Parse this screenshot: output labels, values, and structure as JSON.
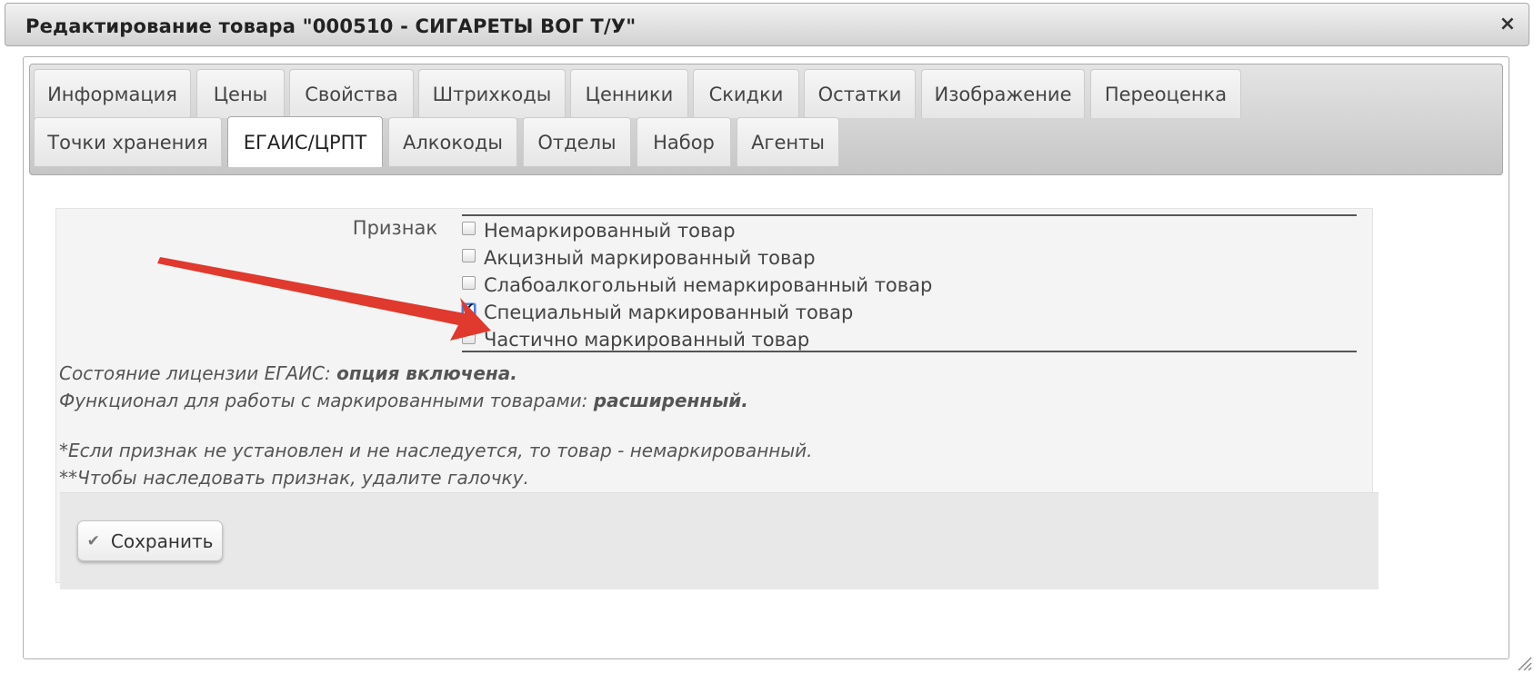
{
  "dialog": {
    "title": "Редактирование товара \"000510 - СИГАРЕТЫ ВОГ Т/У\"",
    "close_symbol": "×"
  },
  "tabs": {
    "row1": [
      {
        "label": "Информация"
      },
      {
        "label": "Цены"
      },
      {
        "label": "Свойства"
      },
      {
        "label": "Штрихкоды"
      },
      {
        "label": "Ценники"
      },
      {
        "label": "Скидки"
      },
      {
        "label": "Остатки"
      },
      {
        "label": "Изображение"
      },
      {
        "label": "Переоценка"
      }
    ],
    "row2": [
      {
        "label": "Точки хранения"
      },
      {
        "label": "ЕГАИС/ЦРПТ",
        "active": true
      },
      {
        "label": "Алкокоды"
      },
      {
        "label": "Отделы"
      },
      {
        "label": "Набор"
      },
      {
        "label": "Агенты"
      }
    ]
  },
  "form": {
    "property_label": "Признак",
    "options": [
      {
        "label": "Немаркированный товар",
        "checked": false
      },
      {
        "label": "Акцизный маркированный товар",
        "checked": false
      },
      {
        "label": "Слабоалкогольный немаркированный товар",
        "checked": false
      },
      {
        "label": "Специальный маркированный товар",
        "checked": true
      },
      {
        "label": "Частично маркированный товар",
        "checked": false
      }
    ]
  },
  "info": {
    "license_prefix": "Состояние лицензии ЕГАИС: ",
    "license_value": "опция включена.",
    "functional_prefix": "Функционал для работы с маркированными товарами: ",
    "functional_value": "расширенный.",
    "note1": "*Если признак не установлен и не наследуется, то товар - немаркированный.",
    "note2": "**Чтобы наследовать признак, удалите галочку."
  },
  "footer": {
    "save_label": "Сохранить",
    "save_icon": "check-icon"
  },
  "annotation": {
    "arrow_color": "#e0392e"
  }
}
